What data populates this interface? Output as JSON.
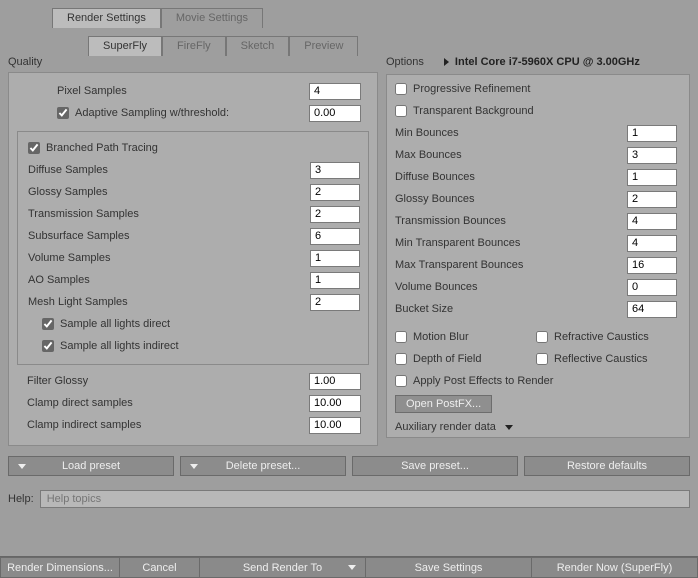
{
  "tabs_main": {
    "render": "Render Settings",
    "movie": "Movie Settings"
  },
  "subtabs": {
    "superfly": "SuperFly",
    "firefly": "FireFly",
    "sketch": "Sketch",
    "preview": "Preview"
  },
  "quality": {
    "title": "Quality",
    "pixel_samples_l": "Pixel Samples",
    "pixel_samples_v": "4",
    "adaptive_l": "Adaptive Sampling w/threshold:",
    "adaptive_v": "0.00",
    "bpt_l": "Branched Path Tracing",
    "diffuse_l": "Diffuse Samples",
    "diffuse_v": "3",
    "glossy_l": "Glossy Samples",
    "glossy_v": "2",
    "trans_l": "Transmission Samples",
    "trans_v": "2",
    "sss_l": "Subsurface Samples",
    "sss_v": "6",
    "vol_l": "Volume Samples",
    "vol_v": "1",
    "ao_l": "AO Samples",
    "ao_v": "1",
    "mesh_l": "Mesh Light Samples",
    "mesh_v": "2",
    "sald_l": "Sample all lights direct",
    "sali_l": "Sample all lights indirect",
    "filter_l": "Filter Glossy",
    "filter_v": "1.00",
    "clampd_l": "Clamp direct samples",
    "clampd_v": "10.00",
    "clampi_l": "Clamp indirect samples",
    "clampi_v": "10.00"
  },
  "options": {
    "title": "Options",
    "device": "Intel Core i7-5960X CPU @ 3.00GHz",
    "prog_l": "Progressive Refinement",
    "trbg_l": "Transparent Background",
    "minb_l": "Min Bounces",
    "minb_v": "1",
    "maxb_l": "Max Bounces",
    "maxb_v": "3",
    "diffb_l": "Diffuse Bounces",
    "diffb_v": "1",
    "glosb_l": "Glossy Bounces",
    "glosb_v": "2",
    "tranb_l": "Transmission Bounces",
    "tranb_v": "4",
    "mintb_l": "Min Transparent Bounces",
    "mintb_v": "4",
    "maxtb_l": "Max Transparent Bounces",
    "maxtb_v": "16",
    "volb_l": "Volume Bounces",
    "volb_v": "0",
    "bucket_l": "Bucket Size",
    "bucket_v": "64",
    "mblur_l": "Motion Blur",
    "refrac_l": "Refractive Caustics",
    "dof_l": "Depth of Field",
    "reflec_l": "Reflective Caustics",
    "postfx_l": "Apply Post Effects to Render",
    "openfx": "Open PostFX...",
    "aux": "Auxiliary render data"
  },
  "presets": {
    "load": "Load preset",
    "delete": "Delete preset...",
    "save": "Save preset...",
    "restore": "Restore defaults"
  },
  "help": {
    "label": "Help:",
    "placeholder": "Help topics"
  },
  "footer": {
    "dim": "Render Dimensions...",
    "cancel": "Cancel",
    "sendto": "Send Render To",
    "savesettings": "Save Settings",
    "rendernow": "Render Now (SuperFly)"
  }
}
